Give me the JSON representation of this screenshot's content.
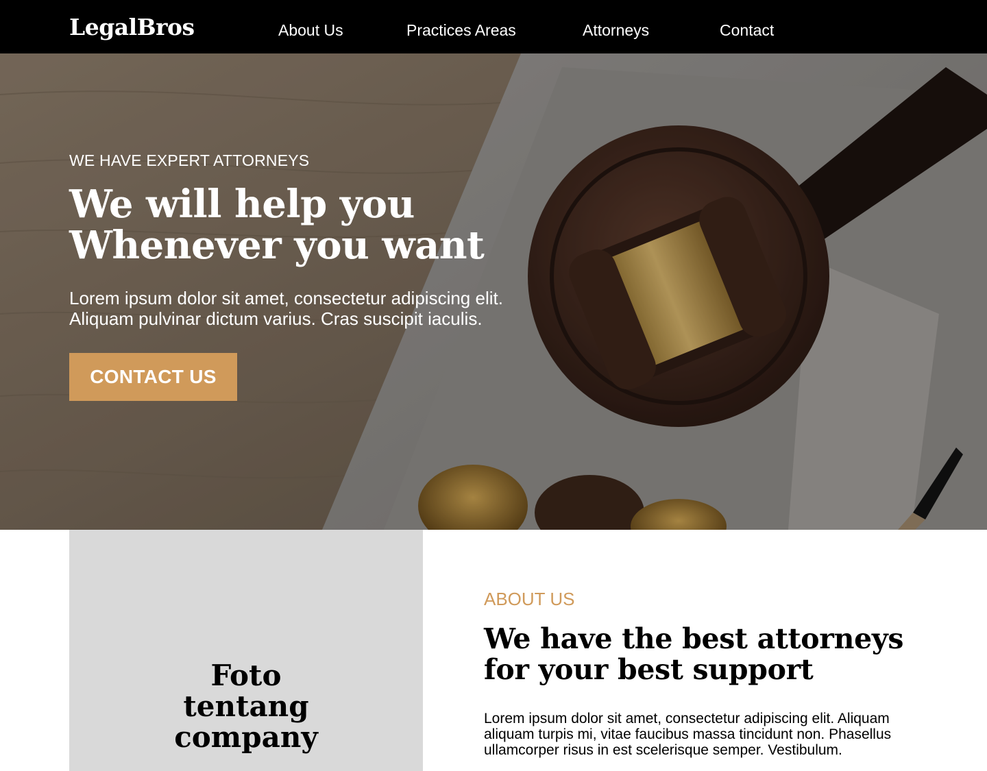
{
  "nav": {
    "logo": "LegalBros",
    "links": [
      "About Us",
      "Practices Areas",
      "Attorneys",
      "Contact"
    ]
  },
  "hero": {
    "eyebrow": "WE HAVE EXPERT ATTORNEYS",
    "headline_lines": [
      "We will help you",
      "Whenever you want"
    ],
    "description_lines": [
      "Lorem ipsum dolor sit amet, consectetur adipiscing elit.",
      "Aliquam pulvinar dictum varius. Cras suscipit iaculis."
    ],
    "cta_label": "CONTACT US"
  },
  "about": {
    "photo_label_lines": [
      "Foto",
      "tentang",
      "company"
    ],
    "eyebrow": "ABOUT US",
    "title_lines": [
      "We have the best attorneys",
      "for your best support"
    ],
    "description_lines": [
      "Lorem ipsum dolor sit amet, consectetur adipiscing elit. Aliquam",
      "aliquam turpis mi, vitae faucibus massa tincidunt non. Phasellus",
      "ullamcorper risus in est scelerisque semper. Vestibulum."
    ]
  },
  "colors": {
    "nav_bg": "#000000",
    "accent": "#d09a5a",
    "placeholder_gray": "#d9d9d9"
  }
}
